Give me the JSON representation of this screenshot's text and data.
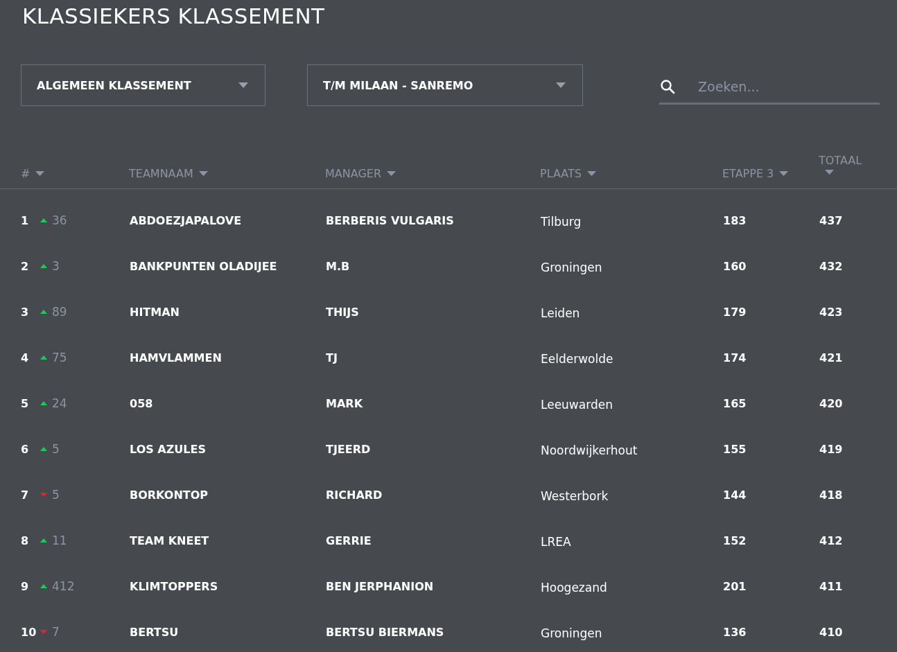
{
  "title": "KLASSIEKERS KLASSEMENT",
  "filters": [
    {
      "value": "ALGEMEEN KLASSEMENT"
    },
    {
      "value": "T/M MILAAN - SANREMO"
    }
  ],
  "search": {
    "placeholder": "Zoeken..."
  },
  "table": {
    "columns": [
      "#",
      "TEAMNAAM",
      "MANAGER",
      "PLAATS",
      "ETAPPE 3",
      "TOTAAL"
    ],
    "rows": [
      {
        "rank": "1",
        "kind": "up",
        "change": "36",
        "team": "ABDOEZJAPALOVE",
        "manager": "BERBERIS VULGARIS",
        "place": "Tilburg",
        "stage": "183",
        "total": "437"
      },
      {
        "rank": "2",
        "kind": "up",
        "change": "3",
        "team": "BANKPUNTEN OLADIJEE",
        "manager": "M.B",
        "place": "Groningen",
        "stage": "160",
        "total": "432"
      },
      {
        "rank": "3",
        "kind": "up",
        "change": "89",
        "team": "HITMAN",
        "manager": "THIJS",
        "place": "Leiden",
        "stage": "179",
        "total": "423"
      },
      {
        "rank": "4",
        "kind": "up",
        "change": "75",
        "team": "HAMVLAMMEN",
        "manager": "TJ",
        "place": "Eelderwolde",
        "stage": "174",
        "total": "421"
      },
      {
        "rank": "5",
        "kind": "up",
        "change": "24",
        "team": "058",
        "manager": "MARK",
        "place": "Leeuwarden",
        "stage": "165",
        "total": "420"
      },
      {
        "rank": "6",
        "kind": "up",
        "change": "5",
        "team": "LOS AZULES",
        "manager": "TJEERD",
        "place": "Noordwijkerhout",
        "stage": "155",
        "total": "419"
      },
      {
        "rank": "7",
        "kind": "down",
        "change": "5",
        "team": "BORKONTOP",
        "manager": "RICHARD",
        "place": "Westerbork",
        "stage": "144",
        "total": "418"
      },
      {
        "rank": "8",
        "kind": "up",
        "change": "11",
        "team": "TEAM KNEET",
        "manager": "GERRIE",
        "place": "LREA",
        "stage": "152",
        "total": "412"
      },
      {
        "rank": "9",
        "kind": "up",
        "change": "412",
        "team": "KLIMTOPPERS",
        "manager": "BEN JERPHANION",
        "place": "Hoogezand",
        "stage": "201",
        "total": "411"
      },
      {
        "rank": "10",
        "kind": "down",
        "change": "7",
        "team": "BERTSU",
        "manager": "BERTSU BIERMANS",
        "place": "Groningen",
        "stage": "136",
        "total": "410"
      }
    ]
  }
}
